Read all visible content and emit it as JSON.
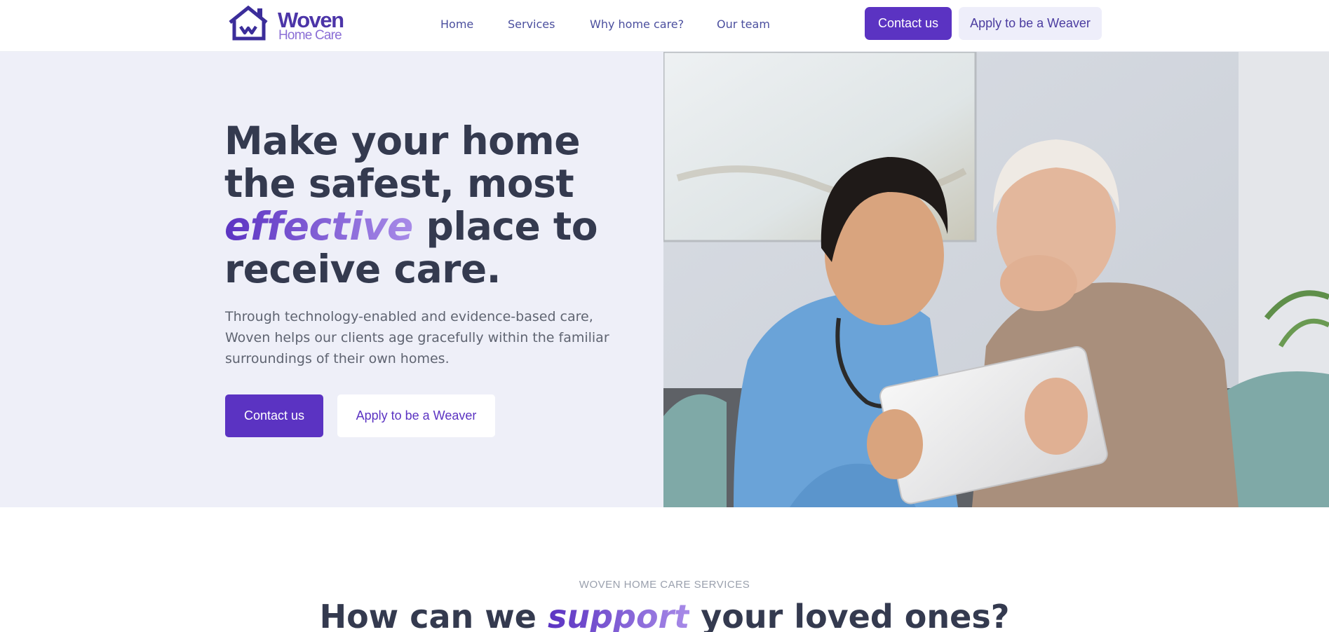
{
  "brand": {
    "name": "Woven",
    "tagline": "Home Care",
    "primary_color": "#5b33c2",
    "accent_light": "#a88be8",
    "hero_bg": "#eeeff8"
  },
  "nav": {
    "items": [
      {
        "label": "Home"
      },
      {
        "label": "Services"
      },
      {
        "label": "Why home care?"
      },
      {
        "label": "Our team"
      }
    ],
    "contact_label": "Contact us",
    "apply_label": "Apply to be a Weaver"
  },
  "hero": {
    "title_part1": "Make your home the safest, most",
    "title_accent": "effective",
    "title_part2": "place to receive care.",
    "description": "Through technology-enabled and evidence-based care, Woven helps our clients age gracefully within the familiar surroundings of their own homes.",
    "contact_label": "Contact us",
    "apply_label": "Apply to be a Weaver",
    "image_icon": "caregiver-with-elderly-woman-photo"
  },
  "services": {
    "eyebrow": "WOVEN HOME CARE SERVICES",
    "heading_part1": "How can we",
    "heading_accent": "support",
    "heading_part2": "your loved ones?"
  }
}
